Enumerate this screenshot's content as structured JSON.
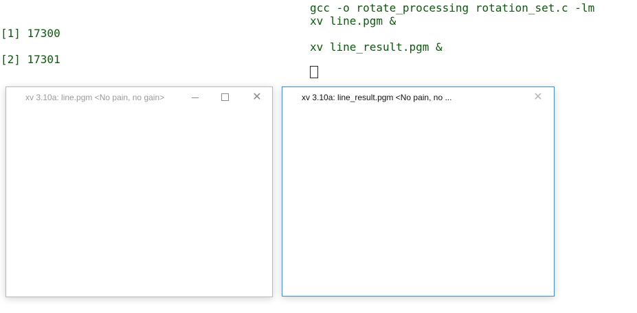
{
  "terminal": {
    "cmd_compile": "gcc -o rotate_processing rotation_set.c -lm",
    "cmd_xv1": "xv line.pgm &",
    "cmd_xv2": "xv line_result.pgm &",
    "job1": "[1] 17300",
    "job2": "[2] 17301"
  },
  "windows": [
    {
      "title": "xv 3.10a: line.pgm  <No pain, no gain>",
      "state": "inactive"
    },
    {
      "title": "xv 3.10a: line_result.pgm  <No pain, no ...",
      "state": "active"
    }
  ],
  "colors": {
    "terminal_text": "#0b5a0b",
    "active_border": "#3c8fd8",
    "inactive_border": "#b8b8b8"
  },
  "icons": {
    "minimize": "minimize-icon",
    "maximize": "maximize-icon",
    "close": "close-icon"
  }
}
